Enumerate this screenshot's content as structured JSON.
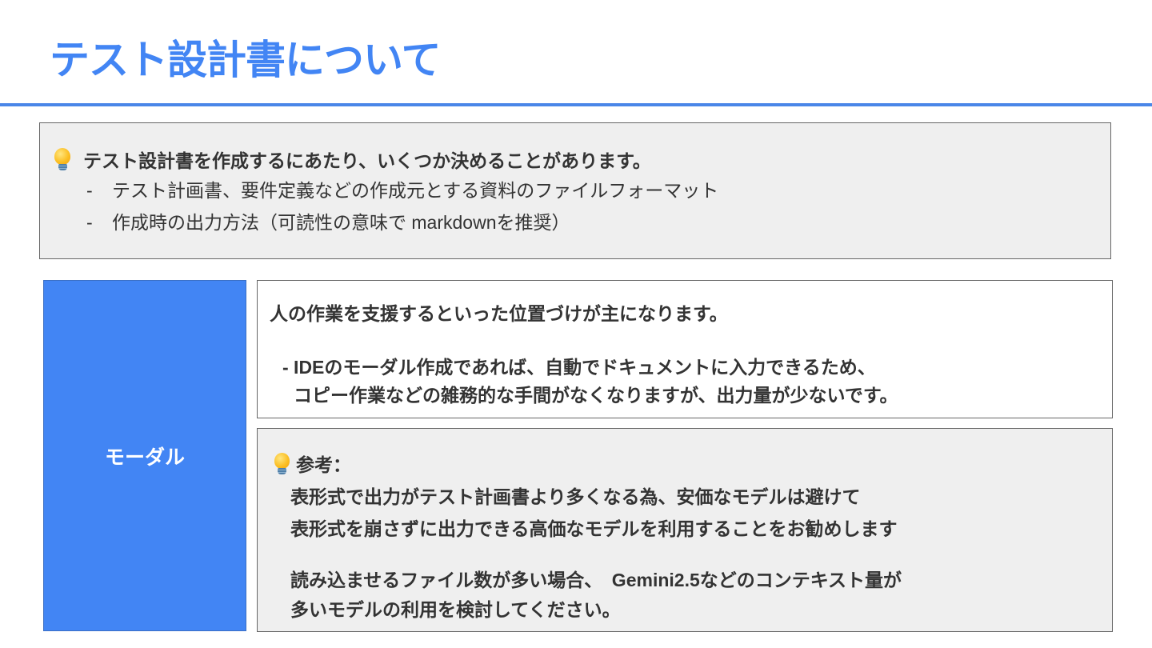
{
  "slide": {
    "title": "テスト設計書について",
    "accent_color": "#4285f4"
  },
  "info_box": {
    "icon": "lightbulb-icon",
    "heading": "テスト設計書を作成するにあたり、いくつか決めることがあります。",
    "items": [
      {
        "marker": "-",
        "text": "テスト計画書、要件定義などの作成元とする資料のファイルフォーマット"
      },
      {
        "marker": "-",
        "text": "作成時の出力方法（可読性の意味で markdownを推奨）"
      }
    ],
    "background": "#efefef"
  },
  "modal_section": {
    "label": "モーダル",
    "label_background": "#4285f4",
    "description": {
      "main": "人の作業を支援するといった位置づけが主になります。",
      "sub_line1": "- IDEのモーダル作成であれば、自動でドキュメントに入力できるため、",
      "sub_line2": "コピー作業などの雑務的な手間がなくなりますが、出力量が少ないです。"
    },
    "reference": {
      "icon": "lightbulb-icon",
      "heading": "参考：",
      "line1": "表形式で出力がテスト計画書より多くなる為、安価なモデルは避けて",
      "line2": "表形式を崩さずに出力できる高価なモデルを利用することをお勧めします",
      "line3": "読み込ませるファイル数が多い場合、　Gemini2.5などのコンテキスト量が",
      "line4": "多いモデルの利用を検討してください。"
    }
  }
}
